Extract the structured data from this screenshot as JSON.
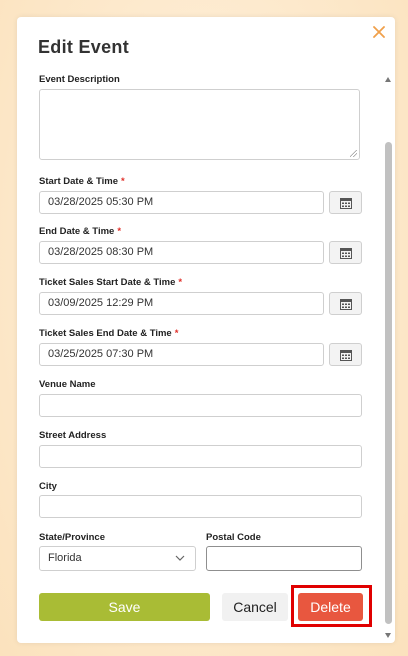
{
  "modal": {
    "title": "Edit Event",
    "close_icon": "close-icon"
  },
  "fields": {
    "event_description": {
      "label": "Event Description",
      "value": ""
    },
    "start_datetime": {
      "label": "Start Date & Time",
      "required_mark": "*",
      "value": "03/28/2025 05:30 PM"
    },
    "end_datetime": {
      "label": "End Date & Time",
      "required_mark": "*",
      "value": "03/28/2025 08:30 PM"
    },
    "ticket_start": {
      "label": "Ticket Sales Start Date & Time",
      "required_mark": "*",
      "value": "03/09/2025 12:29 PM"
    },
    "ticket_end": {
      "label": "Ticket Sales End Date & Time",
      "required_mark": "*",
      "value": "03/25/2025 07:30 PM"
    },
    "venue_name": {
      "label": "Venue Name",
      "value": ""
    },
    "street_address": {
      "label": "Street Address",
      "value": ""
    },
    "city": {
      "label": "City",
      "value": ""
    },
    "state": {
      "label": "State/Province",
      "value": "Florida"
    },
    "postal_code": {
      "label": "Postal Code",
      "value": ""
    }
  },
  "buttons": {
    "save": "Save",
    "cancel": "Cancel",
    "delete": "Delete"
  },
  "colors": {
    "save": "#a9bc35",
    "delete": "#e8573f",
    "close": "#f0a04b",
    "highlight": "#e00000"
  }
}
